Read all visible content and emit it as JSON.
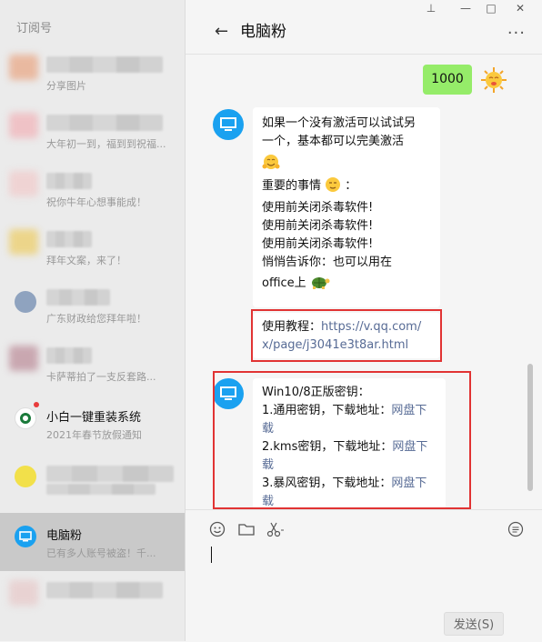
{
  "sidebar": {
    "title": "订阅号",
    "items": [
      {
        "name": "",
        "preview": "分享图片"
      },
      {
        "name": "",
        "preview": "大年初一到，福到到祝福..."
      },
      {
        "name": "",
        "preview": "祝你牛年心想事能成！"
      },
      {
        "name": "",
        "preview": "拜年文案，来了！"
      },
      {
        "name": "",
        "preview": "广东财政给您拜年啦！"
      },
      {
        "name": "",
        "preview": "卡萨蒂拍了一支反套路..."
      },
      {
        "name": "小白一键重装系统",
        "preview": "2021年春节放假通知"
      },
      {
        "name": "",
        "preview": ""
      },
      {
        "name": "电脑粉",
        "preview": "已有多人账号被盗！千..."
      }
    ]
  },
  "window": {
    "pin": "⊥",
    "minimize": "—",
    "maximize": "□",
    "close": "✕"
  },
  "chat": {
    "title": "电脑粉",
    "back": "←",
    "more": "···",
    "my_message": "1000",
    "msg1_lines": [
      "如果一个没有激活可以试试另",
      "一个，基本都可以完美激活"
    ],
    "msg1_important": "重要的事情",
    "msg1_colon": "：",
    "msg1_warn1": "使用前关闭杀毒软件!",
    "msg1_warn2": "使用前关闭杀毒软件!",
    "msg1_warn3": "使用前关闭杀毒软件!",
    "msg1_secret": "悄悄告诉你：也可以用在",
    "msg1_office": "office上",
    "tutorial_label": "使用教程：",
    "tutorial_link_1": "https://v.qq.com/",
    "tutorial_link_2": "x/page/j3041e3t8ar.html",
    "msg2_title": "Win10/8正版密钥：",
    "msg2_row1": "1.通用密钥，下载地址：",
    "msg2_row2": "2.kms密钥，下载地址：",
    "msg2_row3": "3.暴风密钥，下载地址：",
    "disk_link_a": "网盘下",
    "disk_link_b": "载"
  },
  "input": {
    "send_label": "发送(S)"
  },
  "colors": {
    "accent_blue": "#1aa1f0",
    "my_bubble": "#95ec69",
    "highlight_red": "#e13333",
    "link": "#576b95"
  }
}
